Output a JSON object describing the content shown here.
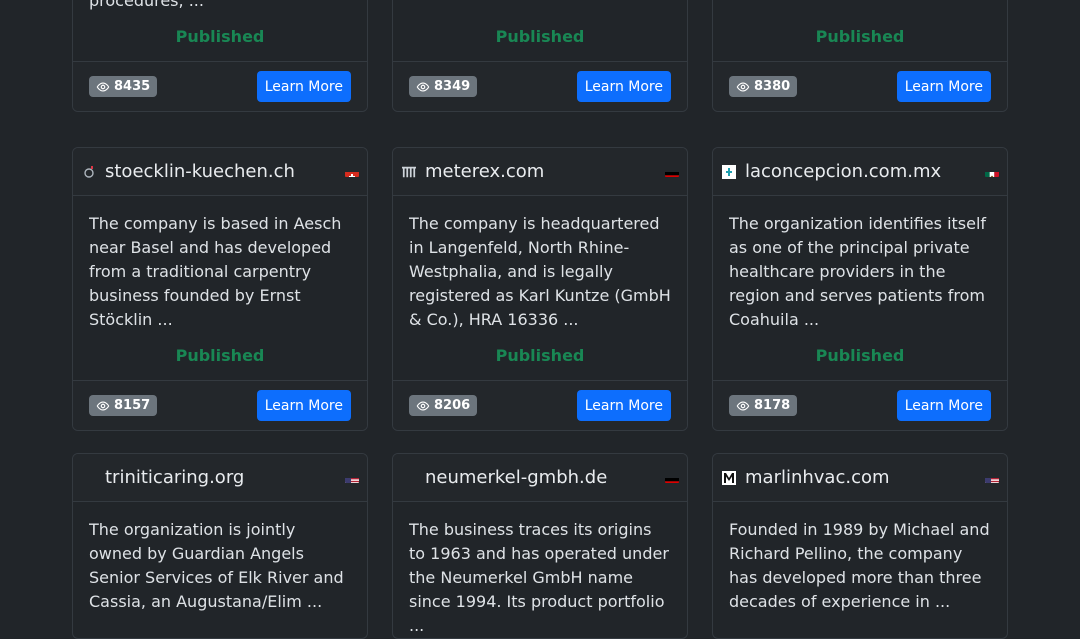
{
  "cards": [
    {
      "domain": "",
      "description": "procedures, ...",
      "status": "Published",
      "views": "8435",
      "button": "Learn More",
      "flag": ""
    },
    {
      "domain": "",
      "description": "",
      "status": "Published",
      "views": "8349",
      "button": "Learn More",
      "flag": ""
    },
    {
      "domain": "",
      "description": "",
      "status": "Published",
      "views": "8380",
      "button": "Learn More",
      "flag": ""
    },
    {
      "domain": "stoecklin-kuechen.ch",
      "description": "The company is based in Aesch near Basel and has developed from a traditional carpentry business founded by Ernst Stöcklin ...",
      "status": "Published",
      "views": "8157",
      "button": "Learn More",
      "flag": "ch",
      "favicon": "o-icon"
    },
    {
      "domain": "meterex.com",
      "description": "The company is headquartered in Langenfeld, North Rhine-Westphalia, and is legally registered as Karl Kuntze (GmbH & Co.), HRA 16336 ...",
      "status": "Published",
      "views": "8206",
      "button": "Learn More",
      "flag": "de",
      "favicon": "bars-icon"
    },
    {
      "domain": "laconcepcion.com.mx",
      "description": "The organization identifies itself as one of the principal private healthcare providers in the region and serves patients from Coahuila ...",
      "status": "Published",
      "views": "8178",
      "button": "Learn More",
      "flag": "mx",
      "favicon": "doc-icon"
    },
    {
      "domain": "triniticaring.org",
      "description": "The organization is jointly owned by Guardian Angels Senior Services of Elk River and Cassia, an Augustana/Elim ...",
      "status": "",
      "views": "",
      "button": "",
      "flag": "us",
      "favicon": ""
    },
    {
      "domain": "neumerkel-gmbh.de",
      "description": "The business traces its origins to 1963 and has operated under the Neumerkel GmbH name since 1994. Its product portfolio ...",
      "status": "",
      "views": "",
      "button": "",
      "flag": "de",
      "favicon": ""
    },
    {
      "domain": "marlinhvac.com",
      "description": "Founded in 1989 by Michael and Richard Pellino, the company has developed more than three decades of experience in ...",
      "status": "",
      "views": "",
      "button": "",
      "flag": "us",
      "favicon": "m-icon"
    }
  ]
}
